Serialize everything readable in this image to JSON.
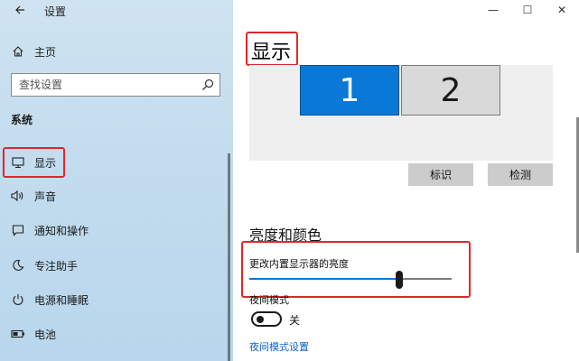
{
  "window": {
    "app_title": "设置",
    "minimize": "—",
    "maximize": "☐",
    "close": "✕"
  },
  "sidebar": {
    "home_label": "主页",
    "search_placeholder": "查找设置",
    "section_header": "系统",
    "items": [
      {
        "label": "显示",
        "icon": "monitor-icon"
      },
      {
        "label": "声音",
        "icon": "speaker-icon"
      },
      {
        "label": "通知和操作",
        "icon": "notification-icon"
      },
      {
        "label": "专注助手",
        "icon": "moon-icon"
      },
      {
        "label": "电源和睡眠",
        "icon": "power-icon"
      },
      {
        "label": "电池",
        "icon": "battery-icon"
      }
    ]
  },
  "main": {
    "page_title": "显示",
    "monitors": [
      {
        "label": "1",
        "selected": true
      },
      {
        "label": "2",
        "selected": false
      }
    ],
    "identify_button": "标识",
    "detect_button": "检测",
    "section_title": "亮度和颜色",
    "brightness_label": "更改内置显示器的亮度",
    "brightness_value": 0.74,
    "night_mode_label": "夜间模式",
    "night_mode_state": "关",
    "night_mode_link": "夜间模式设置"
  },
  "colors": {
    "accent": "#0a78d7",
    "highlight": "#e0262c",
    "sidebar_bg": "#c3dcee"
  }
}
